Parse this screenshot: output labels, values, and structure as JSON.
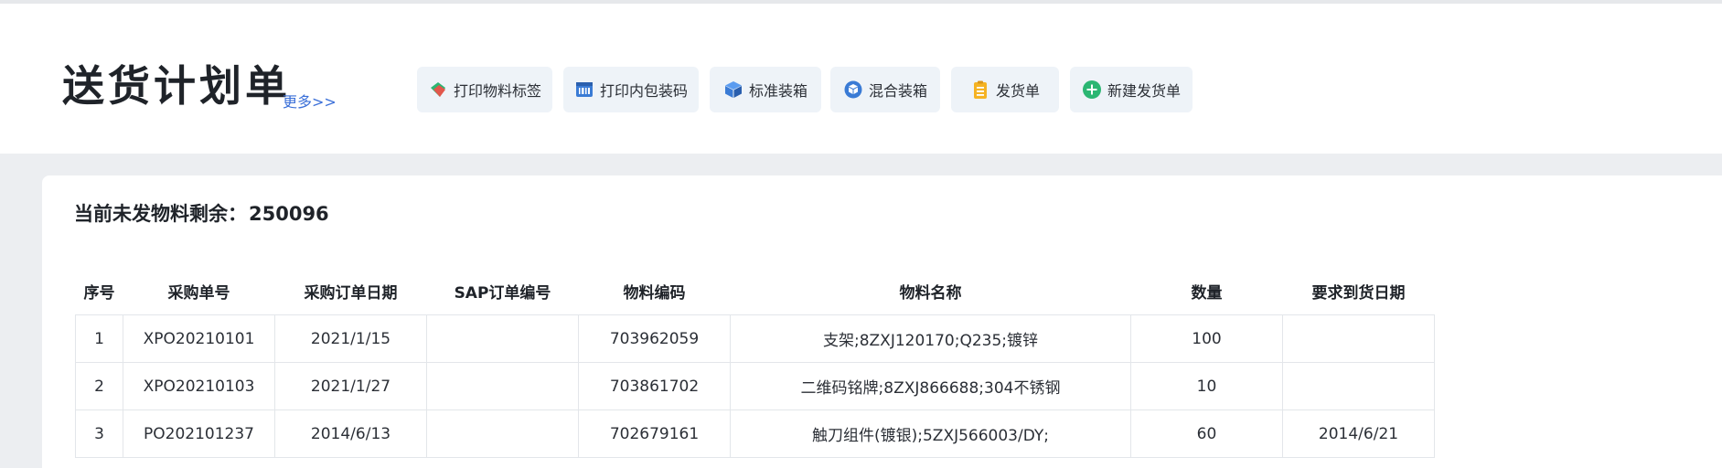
{
  "header": {
    "title": "送货计划单",
    "more_link": "更多>>",
    "buttons": [
      {
        "label": "打印物料标签",
        "icon": "tags-icon",
        "color": "#e2574c"
      },
      {
        "label": "打印内包装码",
        "icon": "barcode-icon",
        "color": "#3a7bd5"
      },
      {
        "label": "标准装箱",
        "icon": "box-icon",
        "color": "#3a7bd5"
      },
      {
        "label": "混合装箱",
        "icon": "mixed-box-icon",
        "color": "#3a7bd5"
      },
      {
        "label": "发货单",
        "icon": "clipboard-icon",
        "color": "#f5b323"
      },
      {
        "label": "新建发货单",
        "icon": "plus-circle-icon",
        "color": "#2bb673"
      }
    ]
  },
  "summary": {
    "label": "当前未发物料剩余：",
    "value": "250096"
  },
  "table": {
    "columns": [
      "序号",
      "采购单号",
      "采购订单日期",
      "SAP订单编号",
      "物料编码",
      "物料名称",
      "数量",
      "要求到货日期"
    ],
    "rows": [
      [
        "1",
        "XPO20210101",
        "2021/1/15",
        "",
        "703962059",
        "支架;8ZXJ120170;Q235;镀锌",
        "100",
        ""
      ],
      [
        "2",
        "XPO20210103",
        "2021/1/27",
        "",
        "703861702",
        "二维码铭牌;8ZXJ866688;304不锈钢",
        "10",
        ""
      ],
      [
        "3",
        "PO202101237",
        "2014/6/13",
        "",
        "702679161",
        "触刀组件(镀银);5ZXJ566003/DY;",
        "60",
        "2014/6/21"
      ]
    ]
  }
}
